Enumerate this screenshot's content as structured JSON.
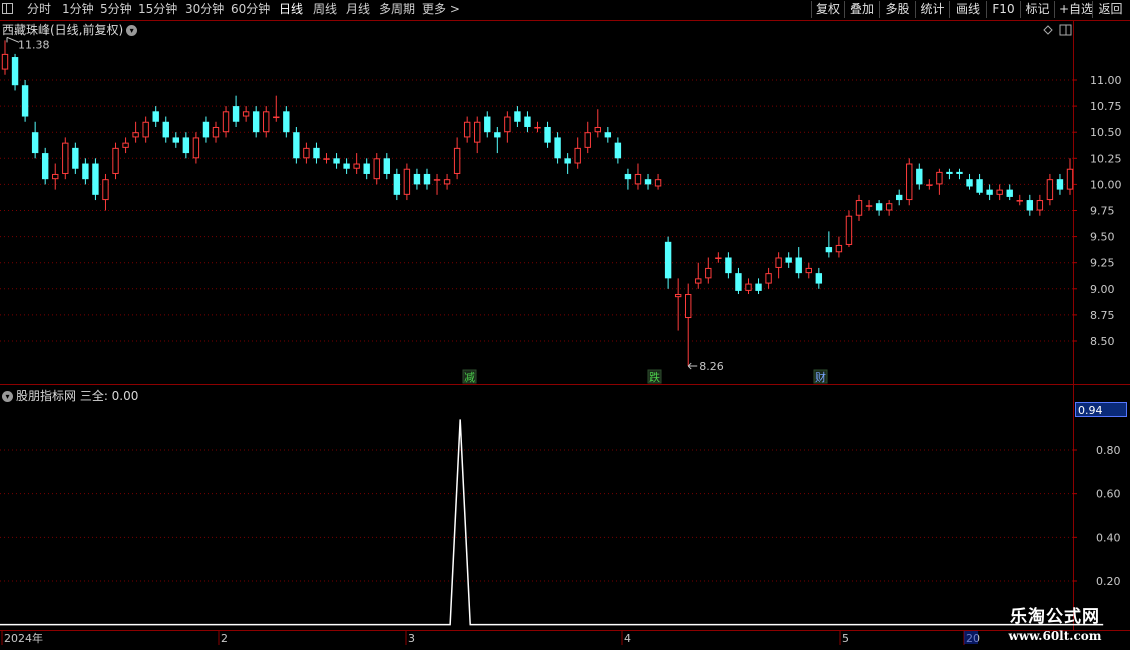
{
  "toolbar": {
    "periods": [
      "分时",
      "1分钟",
      "5分钟",
      "15分钟",
      "30分钟",
      "60分钟",
      "日线",
      "周线",
      "月线",
      "多周期",
      "更多 >"
    ],
    "active_period": "日线",
    "buttons": [
      "复权",
      "叠加",
      "多股",
      "统计",
      "画线",
      "F10",
      "标记",
      "+自选",
      "返回"
    ]
  },
  "main_chart": {
    "title": "西藏珠峰(日线,前复权)",
    "y_ticks": [
      "11.00",
      "10.75",
      "10.50",
      "10.25",
      "10.00",
      "9.75",
      "9.50",
      "9.25",
      "9.00",
      "8.75",
      "8.50"
    ],
    "high_label": "11.38",
    "low_label": "8.26",
    "events": [
      {
        "text": "减",
        "color": "#4cd04c"
      },
      {
        "text": "跌",
        "color": "#4cd04c"
      },
      {
        "text": "财",
        "color": "#7aa8ff"
      }
    ]
  },
  "indicator": {
    "title": "股朋指标网  三全: 0.00",
    "current_value": "0.94",
    "y_ticks": [
      "0.80",
      "0.60",
      "0.40",
      "0.20"
    ]
  },
  "x_axis": {
    "labels": [
      "2024年",
      "2",
      "3",
      "4",
      "5",
      "20"
    ]
  },
  "watermark": {
    "line1": "乐淘公式网",
    "line2": "www.60lt.com"
  },
  "chart_data": {
    "type": "candlestick",
    "title": "西藏珠峰(日线,前复权)",
    "up_color": "#ff3c3c",
    "down_color": "#54ffff",
    "ylim": [
      8.3,
      11.4
    ],
    "candles": [
      [
        11.1,
        11.25,
        11.38,
        11.05
      ],
      [
        11.22,
        10.95,
        11.25,
        10.9
      ],
      [
        10.95,
        10.65,
        11.0,
        10.6
      ],
      [
        10.5,
        10.3,
        10.6,
        10.25
      ],
      [
        10.3,
        10.05,
        10.35,
        10.0
      ],
      [
        10.05,
        10.1,
        10.2,
        9.95
      ],
      [
        10.1,
        10.4,
        10.45,
        10.05
      ],
      [
        10.35,
        10.15,
        10.4,
        10.1
      ],
      [
        10.2,
        10.05,
        10.25,
        10.0
      ],
      [
        10.2,
        9.9,
        10.25,
        9.85
      ],
      [
        9.85,
        10.05,
        10.1,
        9.75
      ],
      [
        10.1,
        10.35,
        10.4,
        10.05
      ],
      [
        10.35,
        10.4,
        10.45,
        10.3
      ],
      [
        10.45,
        10.5,
        10.6,
        10.4
      ],
      [
        10.45,
        10.6,
        10.65,
        10.4
      ],
      [
        10.7,
        10.6,
        10.75,
        10.55
      ],
      [
        10.6,
        10.45,
        10.65,
        10.4
      ],
      [
        10.45,
        10.4,
        10.5,
        10.35
      ],
      [
        10.45,
        10.3,
        10.5,
        10.25
      ],
      [
        10.25,
        10.45,
        10.5,
        10.2
      ],
      [
        10.6,
        10.45,
        10.65,
        10.4
      ],
      [
        10.45,
        10.55,
        10.6,
        10.4
      ],
      [
        10.5,
        10.7,
        10.75,
        10.45
      ],
      [
        10.75,
        10.6,
        10.85,
        10.55
      ],
      [
        10.65,
        10.7,
        10.75,
        10.6
      ],
      [
        10.7,
        10.5,
        10.75,
        10.45
      ],
      [
        10.5,
        10.7,
        10.75,
        10.45
      ],
      [
        10.65,
        10.65,
        10.85,
        10.6
      ],
      [
        10.7,
        10.5,
        10.75,
        10.45
      ],
      [
        10.5,
        10.25,
        10.55,
        10.2
      ],
      [
        10.25,
        10.35,
        10.4,
        10.2
      ],
      [
        10.35,
        10.25,
        10.4,
        10.2
      ],
      [
        10.25,
        10.25,
        10.3,
        10.2
      ],
      [
        10.25,
        10.2,
        10.3,
        10.15
      ],
      [
        10.2,
        10.15,
        10.25,
        10.1
      ],
      [
        10.15,
        10.2,
        10.3,
        10.1
      ],
      [
        10.2,
        10.1,
        10.25,
        10.05
      ],
      [
        10.05,
        10.25,
        10.3,
        10.0
      ],
      [
        10.25,
        10.1,
        10.3,
        10.05
      ],
      [
        10.1,
        9.9,
        10.15,
        9.85
      ],
      [
        9.9,
        10.15,
        10.2,
        9.85
      ],
      [
        10.1,
        10.0,
        10.15,
        9.95
      ],
      [
        10.1,
        10.0,
        10.15,
        9.95
      ],
      [
        10.05,
        10.05,
        10.1,
        9.9
      ],
      [
        10.0,
        10.05,
        10.1,
        9.95
      ],
      [
        10.1,
        10.35,
        10.45,
        10.05
      ],
      [
        10.45,
        10.6,
        10.65,
        10.4
      ],
      [
        10.4,
        10.6,
        10.65,
        10.3
      ],
      [
        10.65,
        10.5,
        10.7,
        10.45
      ],
      [
        10.5,
        10.45,
        10.55,
        10.3
      ],
      [
        10.5,
        10.65,
        10.7,
        10.4
      ],
      [
        10.7,
        10.6,
        10.75,
        10.55
      ],
      [
        10.65,
        10.55,
        10.7,
        10.5
      ],
      [
        10.55,
        10.55,
        10.6,
        10.5
      ],
      [
        10.55,
        10.4,
        10.6,
        10.35
      ],
      [
        10.45,
        10.25,
        10.5,
        10.2
      ],
      [
        10.25,
        10.2,
        10.3,
        10.1
      ],
      [
        10.2,
        10.35,
        10.45,
        10.15
      ],
      [
        10.35,
        10.5,
        10.6,
        10.3
      ],
      [
        10.5,
        10.55,
        10.72,
        10.45
      ],
      [
        10.5,
        10.45,
        10.55,
        10.4
      ],
      [
        10.4,
        10.25,
        10.45,
        10.2
      ],
      [
        10.1,
        10.05,
        10.15,
        9.95
      ],
      [
        10.0,
        10.1,
        10.2,
        9.95
      ],
      [
        10.05,
        10.0,
        10.1,
        9.95
      ],
      [
        9.98,
        10.05,
        10.1,
        9.95
      ],
      [
        9.45,
        9.1,
        9.5,
        9.0
      ],
      [
        8.92,
        8.95,
        9.1,
        8.6
      ],
      [
        8.72,
        8.95,
        9.05,
        8.26
      ],
      [
        9.05,
        9.1,
        9.25,
        9.0
      ],
      [
        9.1,
        9.2,
        9.3,
        9.05
      ],
      [
        9.3,
        9.3,
        9.35,
        9.25
      ],
      [
        9.3,
        9.15,
        9.35,
        9.1
      ],
      [
        9.15,
        8.98,
        9.2,
        8.95
      ],
      [
        8.98,
        9.05,
        9.1,
        8.95
      ],
      [
        9.05,
        8.98,
        9.1,
        8.95
      ],
      [
        9.05,
        9.15,
        9.2,
        9.0
      ],
      [
        9.2,
        9.3,
        9.35,
        9.1
      ],
      [
        9.3,
        9.25,
        9.35,
        9.2
      ],
      [
        9.3,
        9.15,
        9.4,
        9.1
      ],
      [
        9.15,
        9.2,
        9.25,
        9.1
      ],
      [
        9.15,
        9.05,
        9.2,
        9.0
      ],
      [
        9.4,
        9.35,
        9.55,
        9.3
      ],
      [
        9.35,
        9.42,
        9.5,
        9.3
      ],
      [
        9.42,
        9.7,
        9.75,
        9.4
      ],
      [
        9.7,
        9.85,
        9.9,
        9.65
      ],
      [
        9.8,
        9.8,
        9.85,
        9.75
      ],
      [
        9.82,
        9.75,
        9.85,
        9.7
      ],
      [
        9.75,
        9.82,
        9.85,
        9.7
      ],
      [
        9.9,
        9.85,
        9.95,
        9.8
      ],
      [
        9.85,
        10.2,
        10.25,
        9.8
      ],
      [
        10.15,
        10.0,
        10.2,
        9.95
      ],
      [
        10.0,
        10.0,
        10.05,
        9.95
      ],
      [
        10.0,
        10.12,
        10.15,
        9.9
      ],
      [
        10.12,
        10.1,
        10.15,
        10.05
      ],
      [
        10.12,
        10.1,
        10.15,
        10.05
      ],
      [
        10.05,
        9.98,
        10.1,
        9.95
      ],
      [
        10.05,
        9.92,
        10.1,
        9.9
      ],
      [
        9.95,
        9.9,
        10.0,
        9.85
      ],
      [
        9.9,
        9.95,
        10.0,
        9.85
      ],
      [
        9.95,
        9.88,
        10.0,
        9.85
      ],
      [
        9.85,
        9.85,
        9.9,
        9.8
      ],
      [
        9.85,
        9.75,
        9.9,
        9.7
      ],
      [
        9.75,
        9.85,
        9.9,
        9.7
      ],
      [
        9.85,
        10.05,
        10.1,
        9.8
      ],
      [
        10.05,
        9.95,
        10.1,
        9.9
      ],
      [
        9.95,
        10.15,
        10.25,
        9.9
      ]
    ],
    "indicator": {
      "name": "三全",
      "ylim": [
        0,
        1
      ],
      "values_by_index": {
        "0": 0,
        "45": 0,
        "46": 0.94,
        "47": 0,
        "110": 0
      }
    }
  }
}
